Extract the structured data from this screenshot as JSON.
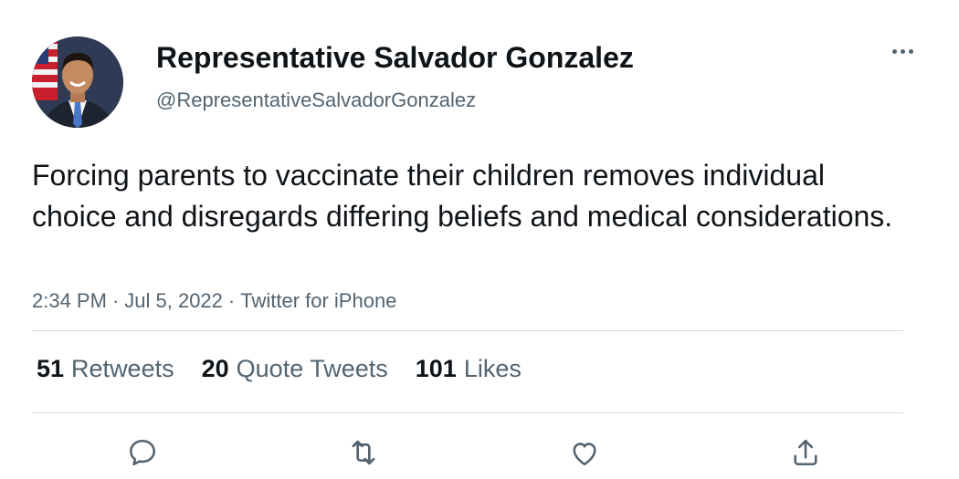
{
  "tweet": {
    "author": {
      "display_name": "Representative Salvador Gonzalez",
      "handle": "@RepresentativeSalvadorGonzalez",
      "avatar_icon": "user-photo"
    },
    "text": "Forcing parents to vaccinate their children removes individual choice and disregards differing beliefs and medical considerations.",
    "meta": {
      "time": "2:34 PM",
      "date": "Jul 5, 2022",
      "source": "Twitter for iPhone",
      "separator": "·"
    },
    "stats": [
      {
        "count": "51",
        "label": "Retweets"
      },
      {
        "count": "20",
        "label": "Quote Tweets"
      },
      {
        "count": "101",
        "label": "Likes"
      }
    ],
    "actions": [
      "reply-icon",
      "retweet-icon",
      "like-icon",
      "share-icon"
    ],
    "colors": {
      "text_primary": "#0f1419",
      "text_secondary": "#536471",
      "divider": "#cfd9de"
    }
  }
}
